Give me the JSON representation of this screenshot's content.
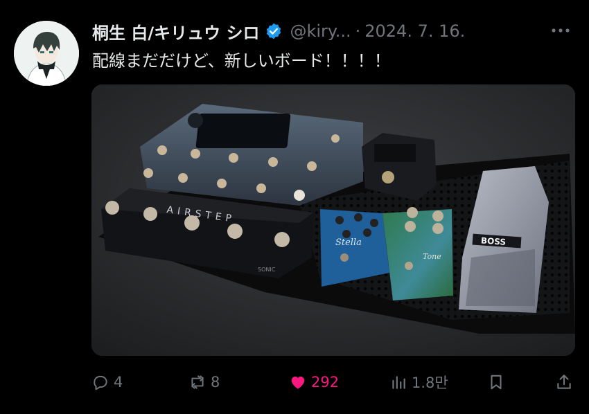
{
  "tweet": {
    "display_name": "桐生 白/キリュウ シロ",
    "handle": "@kiry...",
    "separator": "·",
    "date": "2024. 7. 16.",
    "text": "配線まだだけど、新しいボード！！！！",
    "verified": true
  },
  "media": {
    "pedal_label_airstep": "AIRSTEP",
    "pedal_label_boss": "BOSS",
    "pedal_label_stella": "Stella",
    "pedal_label_tone": "Tone",
    "pedal_label_sonic": "SONIC"
  },
  "actions": {
    "reply_count": "4",
    "retweet_count": "8",
    "like_count": "292",
    "views_count": "1.8만",
    "like_color": "#f91880"
  },
  "icons": [
    "reply-icon",
    "retweet-icon",
    "heart-icon",
    "views-icon",
    "bookmark-icon",
    "share-icon",
    "more-icon",
    "verified-icon"
  ]
}
